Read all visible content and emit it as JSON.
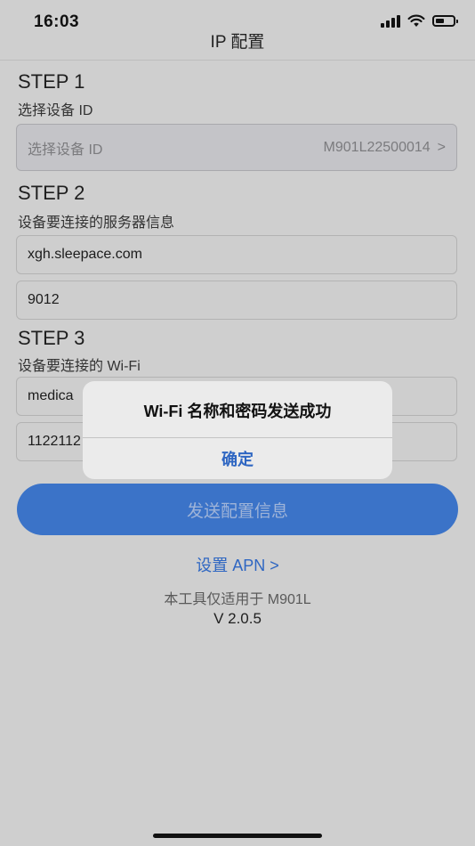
{
  "status_bar": {
    "time": "16:03",
    "icons": [
      "signal-icon",
      "wifi-icon",
      "battery-icon"
    ]
  },
  "nav": {
    "title": "IP 配置"
  },
  "step1": {
    "title": "STEP 1",
    "subtitle": "选择设备 ID",
    "select_placeholder": "选择设备 ID",
    "select_value": "M901L22500014",
    "chevron": ">"
  },
  "step2": {
    "title": "STEP 2",
    "subtitle": "设备要连接的服务器信息",
    "server": "xgh.sleepace.com",
    "port": "9012"
  },
  "step3": {
    "title": "STEP 3",
    "subtitle": "设备要连接的 Wi-Fi",
    "ssid": "medica",
    "password": "1122112"
  },
  "send_button": {
    "label": "发送配置信息"
  },
  "apn_link": {
    "label": "设置 APN >"
  },
  "footer": {
    "note": "本工具仅适用于 M901L",
    "version": "V 2.0.5"
  },
  "alert": {
    "title": "Wi-Fi 名称和密码发送成功",
    "confirm": "确定"
  },
  "colors": {
    "accent": "#3b73c8",
    "link": "#2e66c2",
    "dim_background": "#cfcfcf"
  }
}
